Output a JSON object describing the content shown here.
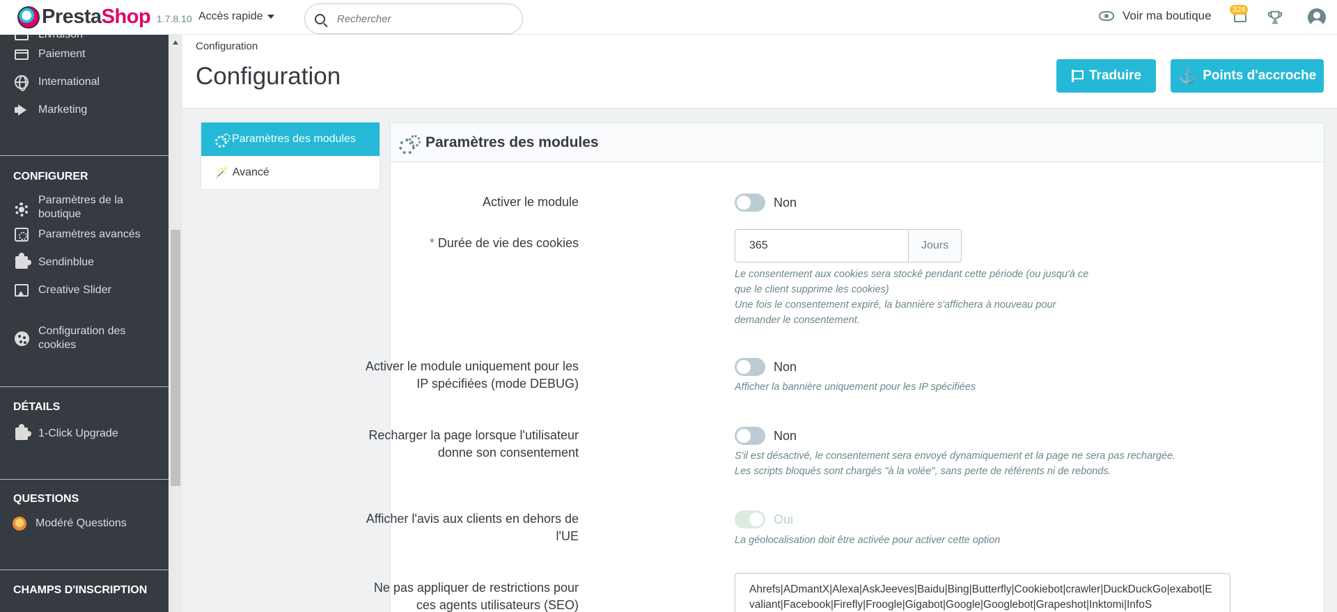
{
  "header": {
    "logo_part1": "Presta",
    "logo_part2": "Shop",
    "version": "1.7.8.10",
    "quick_access": "Accès rapide",
    "search_placeholder": "Rechercher",
    "view_shop": "Voir ma boutique",
    "notifications_count": "324"
  },
  "sidebar": {
    "top_items": [
      {
        "label": "Livraison",
        "icon": "truck-icon"
      },
      {
        "label": "Paiement",
        "icon": "credit-card-icon"
      },
      {
        "label": "International",
        "icon": "globe-icon"
      },
      {
        "label": "Marketing",
        "icon": "megaphone-icon"
      }
    ],
    "sections": [
      {
        "title": "CONFIGURER",
        "items": [
          {
            "label": "Paramètres de la boutique",
            "icon": "gear-icon"
          },
          {
            "label": "Paramètres avancés",
            "icon": "settings-box-icon"
          },
          {
            "label": "Sendinblue",
            "icon": "puzzle-icon"
          },
          {
            "label": "Creative Slider",
            "icon": "image-icon"
          },
          {
            "label": "Configuration des cookies",
            "icon": "cookie-icon"
          }
        ]
      },
      {
        "title": "DÉTAILS",
        "items": [
          {
            "label": "1-Click Upgrade",
            "icon": "puzzle-icon"
          }
        ]
      },
      {
        "title": "QUESTIONS",
        "items": [
          {
            "label": "Modéré Questions",
            "icon": "questions-logo-icon"
          }
        ]
      },
      {
        "title": "CHAMPS D'INSCRIPTION",
        "items": []
      }
    ]
  },
  "page": {
    "breadcrumb": "Configuration",
    "title": "Configuration",
    "buttons": {
      "translate": "Traduire",
      "hooks": "Points d'accroche"
    }
  },
  "tabs": [
    {
      "label": "Paramètres des modules",
      "active": true
    },
    {
      "label": "Avancé",
      "active": false
    }
  ],
  "panel": {
    "title": "Paramètres des modules",
    "fields": {
      "enable_module": {
        "label": "Activer le module",
        "state": "Non"
      },
      "cookie_lifetime": {
        "label": "Durée de vie des cookies",
        "value": "365",
        "unit": "Jours",
        "help_line1": "Le consentement aux cookies sera stocké pendant cette période (ou jusqu'à ce",
        "help_line2": "que le client supprime les cookies)",
        "help_line3": "Une fois le consentement expiré, la bannière s'affichera à nouveau pour",
        "help_line4": "demander le consentement."
      },
      "debug_ip": {
        "label_line1": "Activer le module uniquement pour les",
        "label_line2": "IP spécifiées (mode DEBUG)",
        "state": "Non",
        "help": "Afficher la bannière uniquement pour les IP spécifiées"
      },
      "reload_page": {
        "label_line1": "Recharger la page lorsque l'utilisateur",
        "label_line2": "donne son consentement",
        "state": "Non",
        "help_line1": "S'il est désactivé, le consentement sera envoyé dynamiquement et la page ne sera pas rechargée.",
        "help_line2": "Les scripts bloqués sont chargés \"à la volée\", sans perte de référents ni de rebonds."
      },
      "outside_eu": {
        "label_line1": "Afficher l'avis aux clients en dehors de",
        "label_line2": "l'UE",
        "state": "Oui",
        "help": "La géolocalisation doit être activée pour activer cette option"
      },
      "user_agents": {
        "label_line1": "Ne pas appliquer de restrictions pour",
        "label_line2": "ces agents utilisateurs (SEO)",
        "value": "Ahrefs|ADmantX|Alexa|AskJeeves|Baidu|Bing|Butterfly|Cookiebot|crawler|DuckDuckGo|exabot|Evaliant|Facebook|Firefly|Froogle|Gigabot|Google|Googlebot|Grapeshot|Inktomi|InfoS"
      }
    }
  },
  "colors": {
    "primary": "#25b9d7",
    "sidebar": "#363a41",
    "brand": "#df0067"
  }
}
